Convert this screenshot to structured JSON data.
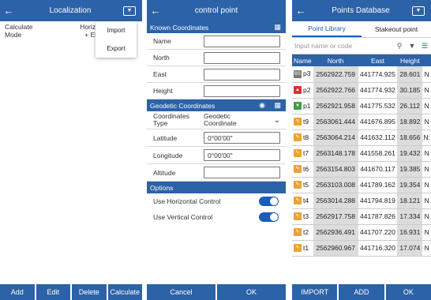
{
  "panel1": {
    "title": "Localization",
    "columns": {
      "calc_mode_line1": "Calculate",
      "calc_mode_line2": "Mode",
      "horiz_line1": "Horizontal co",
      "horiz_line2": "+ Elev_co"
    },
    "menu": [
      "Import",
      "Export"
    ],
    "buttons": [
      "Add",
      "Edit",
      "Delete",
      "Calculate"
    ]
  },
  "panel2": {
    "title": "control point",
    "known_section": "Known Coordinates",
    "known_fields": [
      {
        "label": "Name",
        "value": ""
      },
      {
        "label": "North",
        "value": ""
      },
      {
        "label": "East",
        "value": ""
      },
      {
        "label": "Height",
        "value": ""
      }
    ],
    "geodetic_section": "Geodetic Coordinates",
    "coord_type_label_1": "Coordinates",
    "coord_type_label_2": "Type",
    "coord_type_value_1": "Geodetic",
    "coord_type_value_2": "Coordinate",
    "geo_fields": [
      {
        "label": "Latitude",
        "value": "0°00'00\""
      },
      {
        "label": "Longitude",
        "value": "0°00'00\""
      },
      {
        "label": "Altitude",
        "value": ""
      }
    ],
    "options_section": "Options",
    "options": [
      {
        "label": "Use Horizontal Control",
        "on": true
      },
      {
        "label": "Use Vertical Control",
        "on": true
      }
    ],
    "buttons": [
      "Cancel",
      "OK"
    ]
  },
  "panel3": {
    "title": "Points Database",
    "tabs": [
      "Point Library",
      "Stakeout point"
    ],
    "search_placeholder": "Input name or code",
    "columns": [
      "Name",
      "North",
      "East",
      "Height",
      ""
    ],
    "rows": [
      {
        "icon": "base",
        "name": "p3",
        "north": "2562922.759",
        "east": "441774.925",
        "height": "28.601",
        "extra": "N"
      },
      {
        "icon": "known",
        "name": "p2",
        "north": "2562922.766",
        "east": "441774.932",
        "height": "30.185",
        "extra": "N"
      },
      {
        "icon": "control",
        "name": "p1",
        "north": "2562921.958",
        "east": "441775.532",
        "height": "26.112",
        "extra": "N"
      },
      {
        "icon": "survey",
        "name": "t9",
        "north": "2563061.444",
        "east": "441676.895",
        "height": "18.892",
        "extra": "N"
      },
      {
        "icon": "survey",
        "name": "t8",
        "north": "2563064.214",
        "east": "441632.112",
        "height": "18.656",
        "extra": "N:"
      },
      {
        "icon": "survey",
        "name": "t7",
        "north": "2563148.178",
        "east": "441558.261",
        "height": "19.432",
        "extra": "N"
      },
      {
        "icon": "survey",
        "name": "t6",
        "north": "2563154.803",
        "east": "441670.117",
        "height": "19.385",
        "extra": "N"
      },
      {
        "icon": "survey",
        "name": "t5",
        "north": "2563103.008",
        "east": "441789.162",
        "height": "19.354",
        "extra": "N"
      },
      {
        "icon": "survey",
        "name": "t4",
        "north": "2563014.288",
        "east": "441794.819",
        "height": "18.121",
        "extra": "N"
      },
      {
        "icon": "survey",
        "name": "t3",
        "north": "2562917.758",
        "east": "441787.826",
        "height": "17.334",
        "extra": "N"
      },
      {
        "icon": "survey",
        "name": "t2",
        "north": "2562936.491",
        "east": "441707.220",
        "height": "16.931",
        "extra": "N"
      },
      {
        "icon": "survey",
        "name": "t1",
        "north": "2562960.967",
        "east": "441716.320",
        "height": "17.074",
        "extra": "N"
      }
    ],
    "buttons": [
      "IMPORT",
      "ADD",
      "OK"
    ]
  },
  "colors": {
    "accent": "#2c62a8",
    "toggle": "#1a5db8",
    "survey_icon": "#f0a030",
    "known_icon": "#e03030",
    "control_icon": "#3aa040"
  }
}
